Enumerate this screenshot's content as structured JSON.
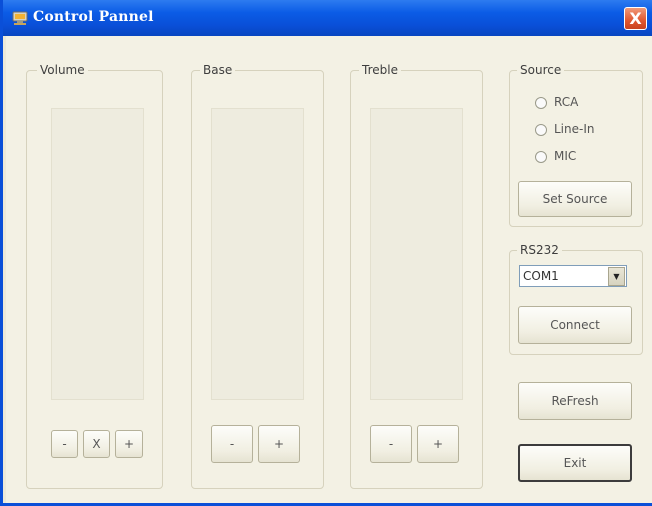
{
  "window": {
    "title": "Control Pannel",
    "close_label": "X"
  },
  "volume": {
    "label": "Volume",
    "minus": "-",
    "mute": "X",
    "plus": "+"
  },
  "base": {
    "label": "Base",
    "minus": "-",
    "plus": "+"
  },
  "treble": {
    "label": "Treble",
    "minus": "-",
    "plus": "+"
  },
  "source": {
    "label": "Source",
    "options": [
      "RCA",
      "Line-In",
      "MIC"
    ],
    "set_button": "Set Source"
  },
  "rs232": {
    "label": "RS232",
    "port_value": "COM1",
    "connect_button": "Connect"
  },
  "refresh_button": "ReFresh",
  "exit_button": "Exit"
}
